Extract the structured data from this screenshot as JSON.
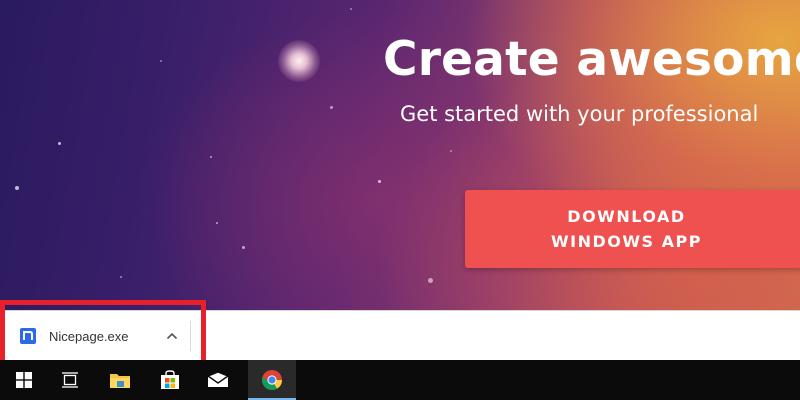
{
  "hero": {
    "headline": "Create awesome",
    "subheadline": "Get started with your professional",
    "download_button": {
      "line1": "DOWNLOAD",
      "line2": "WINDOWS APP"
    }
  },
  "download_bar": {
    "items": [
      {
        "file_name": "Nicepage.exe",
        "icon": "nicepage-icon",
        "menu_icon": "chevron-up-icon"
      }
    ]
  },
  "taskbar": {
    "buttons": [
      {
        "icon": "windows-start-icon"
      },
      {
        "icon": "task-view-icon"
      },
      {
        "icon": "file-explorer-icon"
      },
      {
        "icon": "microsoft-store-icon"
      },
      {
        "icon": "mail-icon"
      },
      {
        "icon": "chrome-icon",
        "active": true
      }
    ]
  },
  "colors": {
    "button": "#ee5150",
    "highlight": "#e8202a",
    "taskbar": "#0b0b0b",
    "nicepage_blue": "#2d6be4"
  }
}
